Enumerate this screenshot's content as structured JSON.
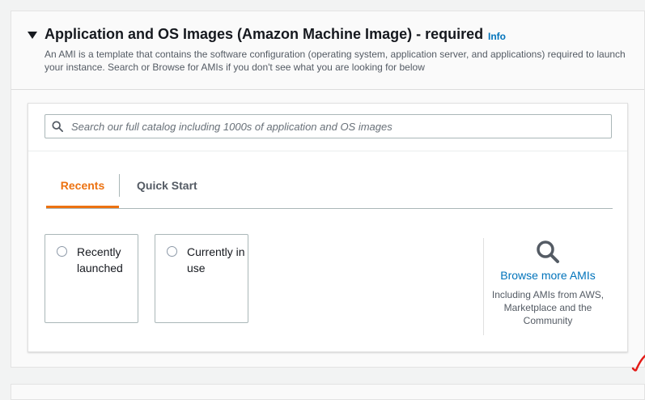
{
  "section": {
    "title": "Application and OS Images (Amazon Machine Image) - required",
    "info_link": "Info",
    "description": "An AMI is a template that contains the software configuration (operating system, application server, and applications) required to launch your instance. Search or Browse for AMIs if you don't see what you are looking for below"
  },
  "search": {
    "placeholder": "Search our full catalog including 1000s of application and OS images",
    "value": ""
  },
  "tabs": [
    {
      "label": "Recents",
      "active": true
    },
    {
      "label": "Quick Start",
      "active": false
    }
  ],
  "options": [
    {
      "label": "Recently launched",
      "selected": false
    },
    {
      "label": "Currently in use",
      "selected": false
    }
  ],
  "browse": {
    "link": "Browse more AMIs",
    "subtitle": "Including AMIs from AWS, Marketplace and the Community",
    "icon": "search-icon"
  },
  "annotation": {
    "icon": "red-checkmark-icon",
    "color": "#e41b17"
  },
  "colors": {
    "accent": "#ec7211",
    "link": "#0073bb",
    "text": "#16191f",
    "muted": "#545b64"
  }
}
